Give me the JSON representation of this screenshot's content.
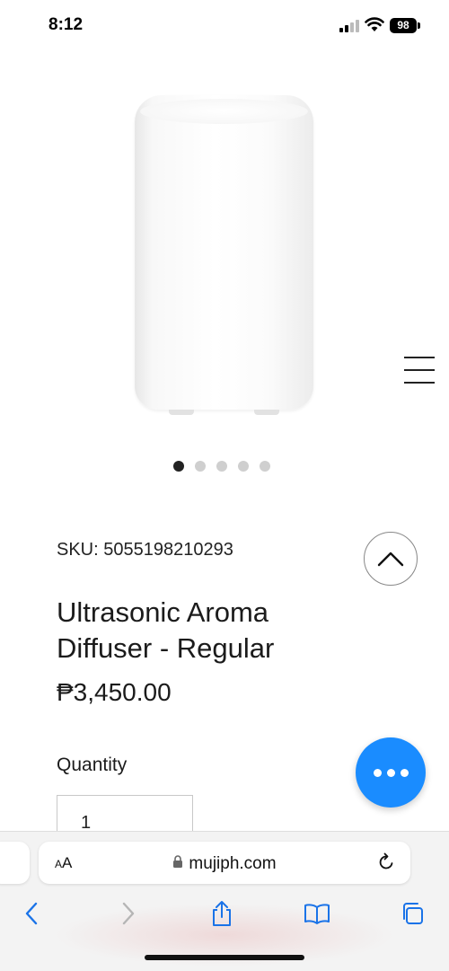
{
  "status_bar": {
    "time": "8:12",
    "battery": "98"
  },
  "product": {
    "sku": "SKU: 5055198210293",
    "title": "Ultrasonic Aroma Diffuser - Regular",
    "price": "₱3,450.00",
    "quantity_label": "Quantity",
    "quantity_value": "1",
    "image_count": 5,
    "active_image": 1
  },
  "browser": {
    "aa_small": "A",
    "aa_large": "A",
    "url": "mujiph.com"
  },
  "colors": {
    "accent": "#1a8cff",
    "text": "#1b1b1b",
    "browser_link": "#1a73e8"
  },
  "icons": [
    "menu-icon",
    "chevron-up-icon",
    "more-dots-icon",
    "lock-icon",
    "reload-icon",
    "back-icon",
    "forward-icon",
    "share-icon",
    "bookmarks-icon",
    "tabs-icon",
    "wifi-icon",
    "signal-icon",
    "battery-icon"
  ]
}
